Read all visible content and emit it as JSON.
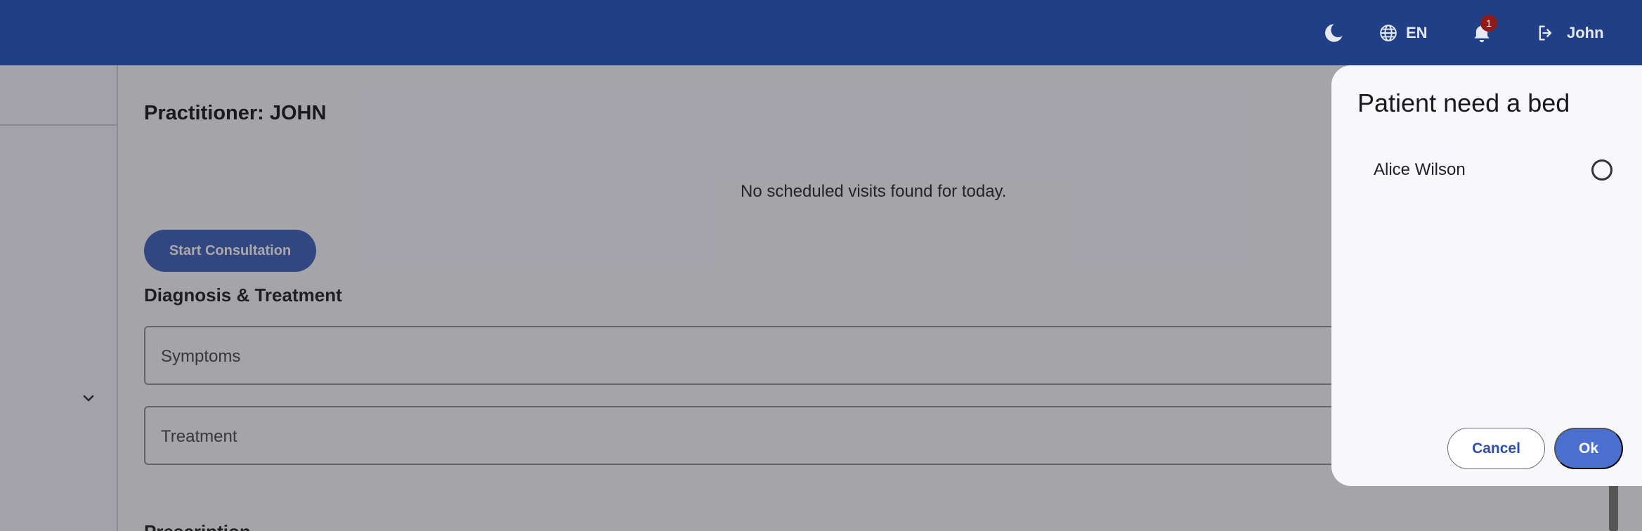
{
  "header": {
    "language": "EN",
    "notification_count": "1",
    "user_name": "John"
  },
  "main": {
    "title": "Practitioner: JOHN",
    "empty_message": "No scheduled visits found for today.",
    "start_button": "Start Consultation",
    "section_heading": "Diagnosis & Treatment",
    "fields": {
      "symptoms_label": "Symptoms",
      "treatment_label": "Treatment"
    },
    "next_section_heading": "Prescription"
  },
  "dialog": {
    "title": "Patient need a bed",
    "options": [
      {
        "name": "Alice Wilson",
        "selected": false
      }
    ],
    "cancel_label": "Cancel",
    "ok_label": "Ok"
  },
  "colors": {
    "header_bg": "#213f86",
    "primary": "#3a5bb8",
    "badge": "#8e1a1a"
  },
  "icons": [
    "moon-icon",
    "globe-icon",
    "bell-icon",
    "logout-icon",
    "chevron-down-icon"
  ]
}
